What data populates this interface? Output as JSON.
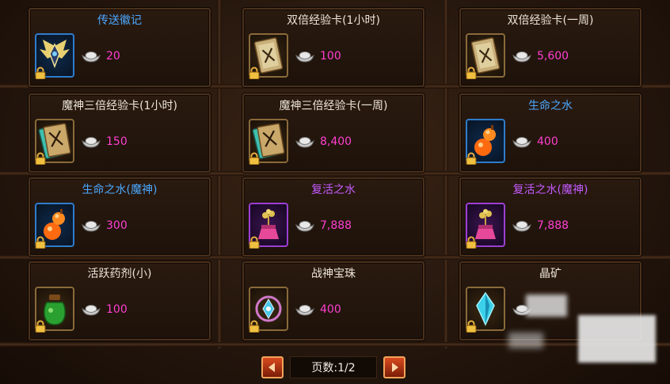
{
  "items": [
    {
      "name": "传送徽记",
      "name_color": "blue",
      "price": "20",
      "icon": "winged-emblem-icon",
      "slot": "blue"
    },
    {
      "name": "双倍经验卡(1小时)",
      "name_color": "white",
      "price": "100",
      "icon": "double-exp-card-icon",
      "slot": "gold"
    },
    {
      "name": "双倍经验卡(一周)",
      "name_color": "white",
      "price": "5,600",
      "icon": "double-exp-card-icon",
      "slot": "gold"
    },
    {
      "name": "魔神三倍经验卡(1小时)",
      "name_color": "white",
      "price": "150",
      "icon": "triple-exp-card-icon",
      "slot": "gold"
    },
    {
      "name": "魔神三倍经验卡(一周)",
      "name_color": "white",
      "price": "8,400",
      "icon": "triple-exp-card-icon",
      "slot": "gold"
    },
    {
      "name": "生命之水",
      "name_color": "blue",
      "price": "400",
      "icon": "gourd-potion-icon",
      "slot": "blue"
    },
    {
      "name": "生命之水(魔神)",
      "name_color": "blue",
      "price": "300",
      "icon": "gourd-potion-icon",
      "slot": "blue"
    },
    {
      "name": "复活之水",
      "name_color": "purple",
      "price": "7,888",
      "icon": "revive-flask-icon",
      "slot": "purple"
    },
    {
      "name": "复活之水(魔神)",
      "name_color": "purple",
      "price": "7,888",
      "icon": "revive-flask-icon",
      "slot": "purple"
    },
    {
      "name": "活跃药剂(小)",
      "name_color": "white",
      "price": "100",
      "icon": "green-potion-jar-icon",
      "slot": "gold"
    },
    {
      "name": "战神宝珠",
      "name_color": "white",
      "price": "400",
      "icon": "war-god-orb-icon",
      "slot": "gold"
    },
    {
      "name": "晶矿",
      "name_color": "white",
      "price": "",
      "icon": "crystal-ore-icon",
      "slot": "gold"
    }
  ],
  "pager": {
    "label": "页数:1/2"
  },
  "currency_icon": "silver-ingot-icon",
  "lock_icon": "lock-icon",
  "colors": {
    "price": "#ff3fd0",
    "name_blue": "#4aa8ff",
    "name_purple": "#c35bff",
    "name_white": "#ece4d6"
  }
}
